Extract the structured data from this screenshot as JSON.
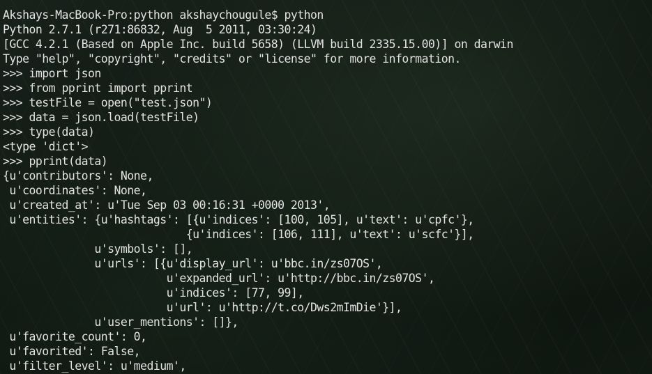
{
  "terminal": {
    "lines": [
      "Akshays-MacBook-Pro:python akshaychougule$ python",
      "Python 2.7.1 (r271:86832, Aug  5 2011, 03:30:24)",
      "[GCC 4.2.1 (Based on Apple Inc. build 5658) (LLVM build 2335.15.00)] on darwin",
      "Type \"help\", \"copyright\", \"credits\" or \"license\" for more information.",
      ">>> import json",
      ">>> from pprint import pprint",
      ">>> testFile = open(\"test.json\")",
      ">>> data = json.load(testFile)",
      ">>> type(data)",
      "<type 'dict'>",
      ">>> pprint(data)",
      "{u'contributors': None,",
      " u'coordinates': None,",
      " u'created_at': u'Tue Sep 03 00:16:31 +0000 2013',",
      " u'entities': {u'hashtags': [{u'indices': [100, 105], u'text': u'cpfc'},",
      "                            {u'indices': [106, 111], u'text': u'scfc'}],",
      "              u'symbols': [],",
      "              u'urls': [{u'display_url': u'bbc.in/zs07OS',",
      "                         u'expanded_url': u'http://bbc.in/zs07OS',",
      "                         u'indices': [77, 99],",
      "                         u'url': u'http://t.co/Dws2mImDie'}],",
      "              u'user_mentions': []},",
      " u'favorite_count': 0,",
      " u'favorited': False,",
      " u'filter_level': u'medium',"
    ]
  }
}
